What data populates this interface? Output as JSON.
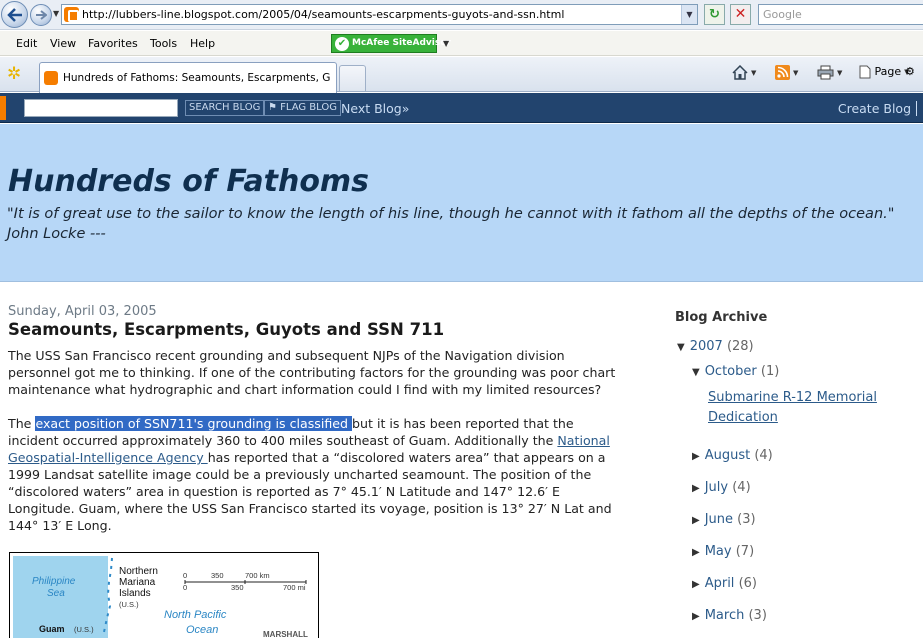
{
  "browser": {
    "url": "http://lubbers-line.blogspot.com/2005/04/seamounts-escarpments-guyots-and-ssn.html",
    "search_placeholder": "Google",
    "menu": [
      "Edit",
      "View",
      "Favorites",
      "Tools",
      "Help"
    ],
    "mcafee_label": "McAfee SiteAdvisor",
    "tab_title": "Hundreds of Fathoms: Seamounts, Escarpments, Guy...",
    "page_cmd": "Page"
  },
  "navbar": {
    "search_button": "SEARCH BLOG",
    "flag_button": "FLAG BLOG",
    "next_blog": "Next Blog»",
    "create_blog": "Create Blog"
  },
  "header": {
    "title": "Hundreds of Fathoms",
    "description": "\"It is of great use to the sailor to know the length of his line, though he cannot with it fathom all the depths of the ocean.\" John Locke ---"
  },
  "post": {
    "date": "Sunday, April 03, 2005",
    "title": "Seamounts, Escarpments, Guyots and SSN 711",
    "para1": "The USS San Francisco recent grounding and subsequent NJPs of the Navigation division personnel got me to thinking. If one of the contributing factors for the grounding was poor chart maintenance what hydrographic and chart information could I find with my limited resources?",
    "para2_pre": "The ",
    "para2_highlight": "exact position of SSN711's grounding is classified ",
    "para2_mid": "but it is has been reported that the incident occurred approximately 360 to 400 miles southeast of Guam. Additionally the ",
    "para2_link": "National Geospatial-Intelligence Agency ",
    "para2_post": "has reported that a “discolored waters area” that appears on a 1999 Landsat satellite image could be a previously uncharted seamount. The position of the “discolored waters” area in question is reported as 7° 45.1′ N Latitude and 147° 12.6′ E Longitude. Guam, where the USS San Francisco started its voyage, position is 13° 27′ N Lat and 144° 13′ E Long."
  },
  "map": {
    "philippine": "Philippine",
    "sea": "Sea",
    "northern": "Northern",
    "mariana": "Mariana",
    "islands": "Islands",
    "us": "(U.S.)",
    "guam": "Guam",
    "guam_us": "(U.S.)",
    "north_pacific": "North   Pacific",
    "ocean": "Ocean",
    "marshall": "MARSHALL",
    "scale_0": "0",
    "scale_350km": "350",
    "scale_700km": "700 km",
    "scale_0b": "0",
    "scale_350mi": "350",
    "scale_700mi": "700 mi"
  },
  "sidebar": {
    "archive_title": "Blog Archive",
    "year": {
      "label": "2007",
      "count": "(28)"
    },
    "october": {
      "label": "October",
      "count": "(1)"
    },
    "post_link": "Submarine R-12 Memorial Dedication",
    "months": [
      {
        "label": "August",
        "count": "(4)"
      },
      {
        "label": "July",
        "count": "(4)"
      },
      {
        "label": "June",
        "count": "(3)"
      },
      {
        "label": "May",
        "count": "(7)"
      },
      {
        "label": "April",
        "count": "(6)"
      },
      {
        "label": "March",
        "count": "(3)"
      }
    ]
  }
}
